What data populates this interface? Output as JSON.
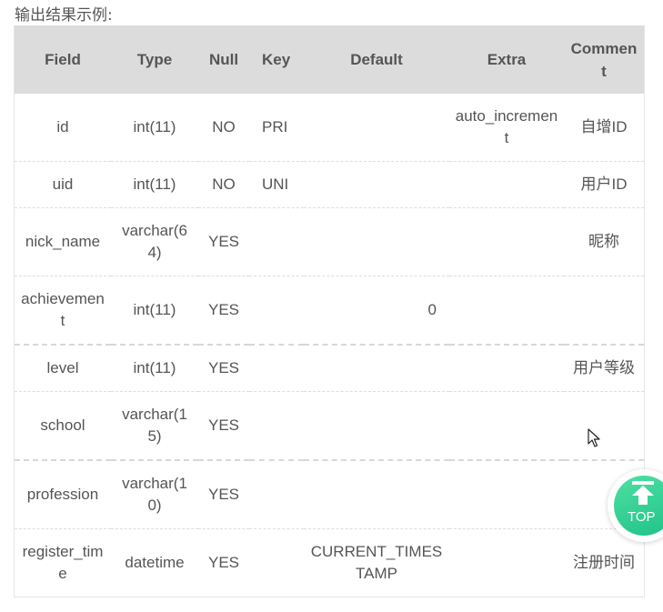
{
  "caption": "输出结果示例:",
  "columns": [
    "Field",
    "Type",
    "Null",
    "Key",
    "Default",
    "Extra",
    "Comment"
  ],
  "rows": [
    {
      "field": "id",
      "type": "int(11)",
      "null": "NO",
      "key": "PRI",
      "default": "",
      "extra": "auto_increment",
      "comment": "自增ID"
    },
    {
      "field": "uid",
      "type": "int(11)",
      "null": "NO",
      "key": "UNI",
      "default": "",
      "extra": "",
      "comment": "用户ID"
    },
    {
      "field": "nick_name",
      "type": "varchar(64)",
      "null": "YES",
      "key": "",
      "default": "",
      "extra": "",
      "comment": "昵称"
    },
    {
      "field": "achievement",
      "type": "int(11)",
      "null": "YES",
      "key": "",
      "default": "0",
      "extra": "",
      "comment": ""
    },
    {
      "field": "level",
      "type": "int(11)",
      "null": "YES",
      "key": "",
      "default": "",
      "extra": "",
      "comment": "用户等级"
    },
    {
      "field": "school",
      "type": "varchar(15)",
      "null": "YES",
      "key": "",
      "default": "",
      "extra": "",
      "comment": ""
    },
    {
      "field": "profession",
      "type": "varchar(10)",
      "null": "YES",
      "key": "",
      "default": "",
      "extra": "",
      "comment": ""
    },
    {
      "field": "register_time",
      "type": "datetime",
      "null": "YES",
      "key": "",
      "default": "CURRENT_TIMESTAMP",
      "extra": "",
      "comment": "注册时间"
    }
  ],
  "top_button": {
    "label": "TOP",
    "icon": "arrow-up-icon"
  },
  "colors": {
    "header_bg": "#dcdcdc",
    "top_button": "#1fc28a"
  }
}
